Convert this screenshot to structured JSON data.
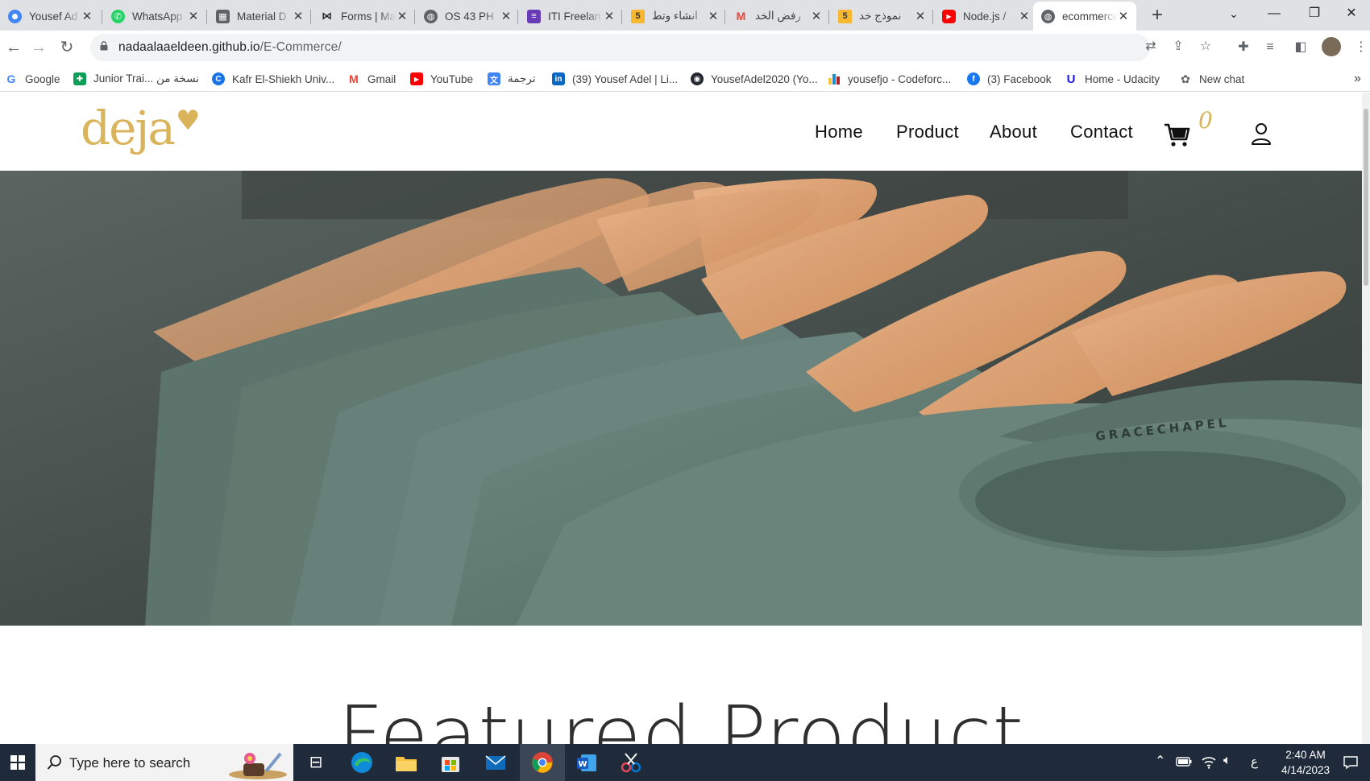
{
  "browser": {
    "tabs": [
      {
        "title": "Yousef Ad",
        "icon": "chromium-icon"
      },
      {
        "title": "WhatsApp",
        "icon": "whatsapp-icon"
      },
      {
        "title": "Material D",
        "icon": "material-icon"
      },
      {
        "title": "Forms | Ma",
        "icon": "bow-tie-icon"
      },
      {
        "title": "OS 43 PH",
        "icon": "globe-icon"
      },
      {
        "title": "ITI Freelan",
        "icon": "forms-icon"
      },
      {
        "title": "انشاء وتط",
        "icon": "khamsat-icon"
      },
      {
        "title": "رفض الخد",
        "icon": "gmail-icon"
      },
      {
        "title": "نموذج خد",
        "icon": "khamsat-icon"
      },
      {
        "title": "Node.js /",
        "icon": "youtube-icon"
      },
      {
        "title": "ecommerce",
        "icon": "globe-icon"
      }
    ],
    "khamsat_badge": "5",
    "new_tab": "+",
    "address": {
      "host": "nadaalaaeldeen.github.io",
      "path": "/E-Commerce/"
    },
    "bookmarks": [
      {
        "label": "Google",
        "icon": "google-icon"
      },
      {
        "label": "Junior Trai... نسخة من",
        "icon": "sheets-icon"
      },
      {
        "label": "Kafr El-Shiekh Univ...",
        "icon": "kfs-icon"
      },
      {
        "label": "Gmail",
        "icon": "gmail-icon"
      },
      {
        "label": "YouTube",
        "icon": "youtube-icon"
      },
      {
        "label": "ترجمة",
        "icon": "translate-icon"
      },
      {
        "label": "(39) Yousef Adel | Li...",
        "icon": "linkedin-icon"
      },
      {
        "label": "YousefAdel2020 (Yo...",
        "icon": "github-icon"
      },
      {
        "label": "yousefjo - Codeforc...",
        "icon": "codeforces-icon"
      },
      {
        "label": "(3) Facebook",
        "icon": "facebook-icon"
      },
      {
        "label": "Home - Udacity",
        "icon": "udacity-icon"
      },
      {
        "label": "New chat",
        "icon": "openai-icon"
      }
    ],
    "bookmarks_overflow": "»"
  },
  "site": {
    "logo": "deja",
    "nav": [
      "Home",
      "Product",
      "About",
      "Contact"
    ],
    "cart_count": "0",
    "hero_print": "GRACECHAPEL",
    "featured_title": "Featured Product"
  },
  "taskbar": {
    "search_placeholder": "Type here to search",
    "input_lang": "ع",
    "time": "2:40 AM",
    "date": "4/14/2023"
  },
  "colors": {
    "brand_gold": "#d9b45a",
    "tab_strip": "#dfe1e5",
    "taskbar": "#1f2b3a"
  }
}
